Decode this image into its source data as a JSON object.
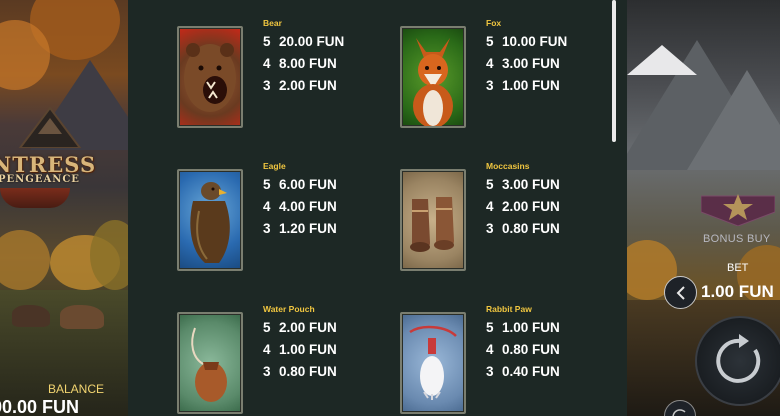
{
  "game": {
    "logo_line1": "NTRESS",
    "logo_line2": "PENGEANCE"
  },
  "balance": {
    "label": "BALANCE",
    "value": "00.00 FUN"
  },
  "controls": {
    "bonus_buy_label": "BONUS BUY",
    "bet_label": "BET",
    "bet_value": "1.00 FUN"
  },
  "paytable": {
    "symbols": [
      {
        "name": "Bear",
        "icon": "bear-icon",
        "pays": [
          {
            "count": "5",
            "value": "20.00 FUN"
          },
          {
            "count": "4",
            "value": "8.00 FUN"
          },
          {
            "count": "3",
            "value": "2.00 FUN"
          }
        ]
      },
      {
        "name": "Fox",
        "icon": "fox-icon",
        "pays": [
          {
            "count": "5",
            "value": "10.00 FUN"
          },
          {
            "count": "4",
            "value": "3.00 FUN"
          },
          {
            "count": "3",
            "value": "1.00 FUN"
          }
        ]
      },
      {
        "name": "Eagle",
        "icon": "eagle-icon",
        "pays": [
          {
            "count": "5",
            "value": "6.00 FUN"
          },
          {
            "count": "4",
            "value": "4.00 FUN"
          },
          {
            "count": "3",
            "value": "1.20 FUN"
          }
        ]
      },
      {
        "name": "Moccasins",
        "icon": "moccasins-icon",
        "pays": [
          {
            "count": "5",
            "value": "3.00 FUN"
          },
          {
            "count": "4",
            "value": "2.00 FUN"
          },
          {
            "count": "3",
            "value": "0.80 FUN"
          }
        ]
      },
      {
        "name": "Water Pouch",
        "icon": "water-pouch-icon",
        "pays": [
          {
            "count": "5",
            "value": "2.00 FUN"
          },
          {
            "count": "4",
            "value": "1.00 FUN"
          },
          {
            "count": "3",
            "value": "0.80 FUN"
          }
        ]
      },
      {
        "name": "Rabbit Paw",
        "icon": "rabbit-paw-icon",
        "pays": [
          {
            "count": "5",
            "value": "1.00 FUN"
          },
          {
            "count": "4",
            "value": "0.80 FUN"
          },
          {
            "count": "3",
            "value": "0.40 FUN"
          }
        ]
      }
    ]
  },
  "colors": {
    "panel_bg": "#1d2825",
    "symbol_name": "#f0c640",
    "pay_text": "#ffffff",
    "balance_label": "#f2d470"
  }
}
